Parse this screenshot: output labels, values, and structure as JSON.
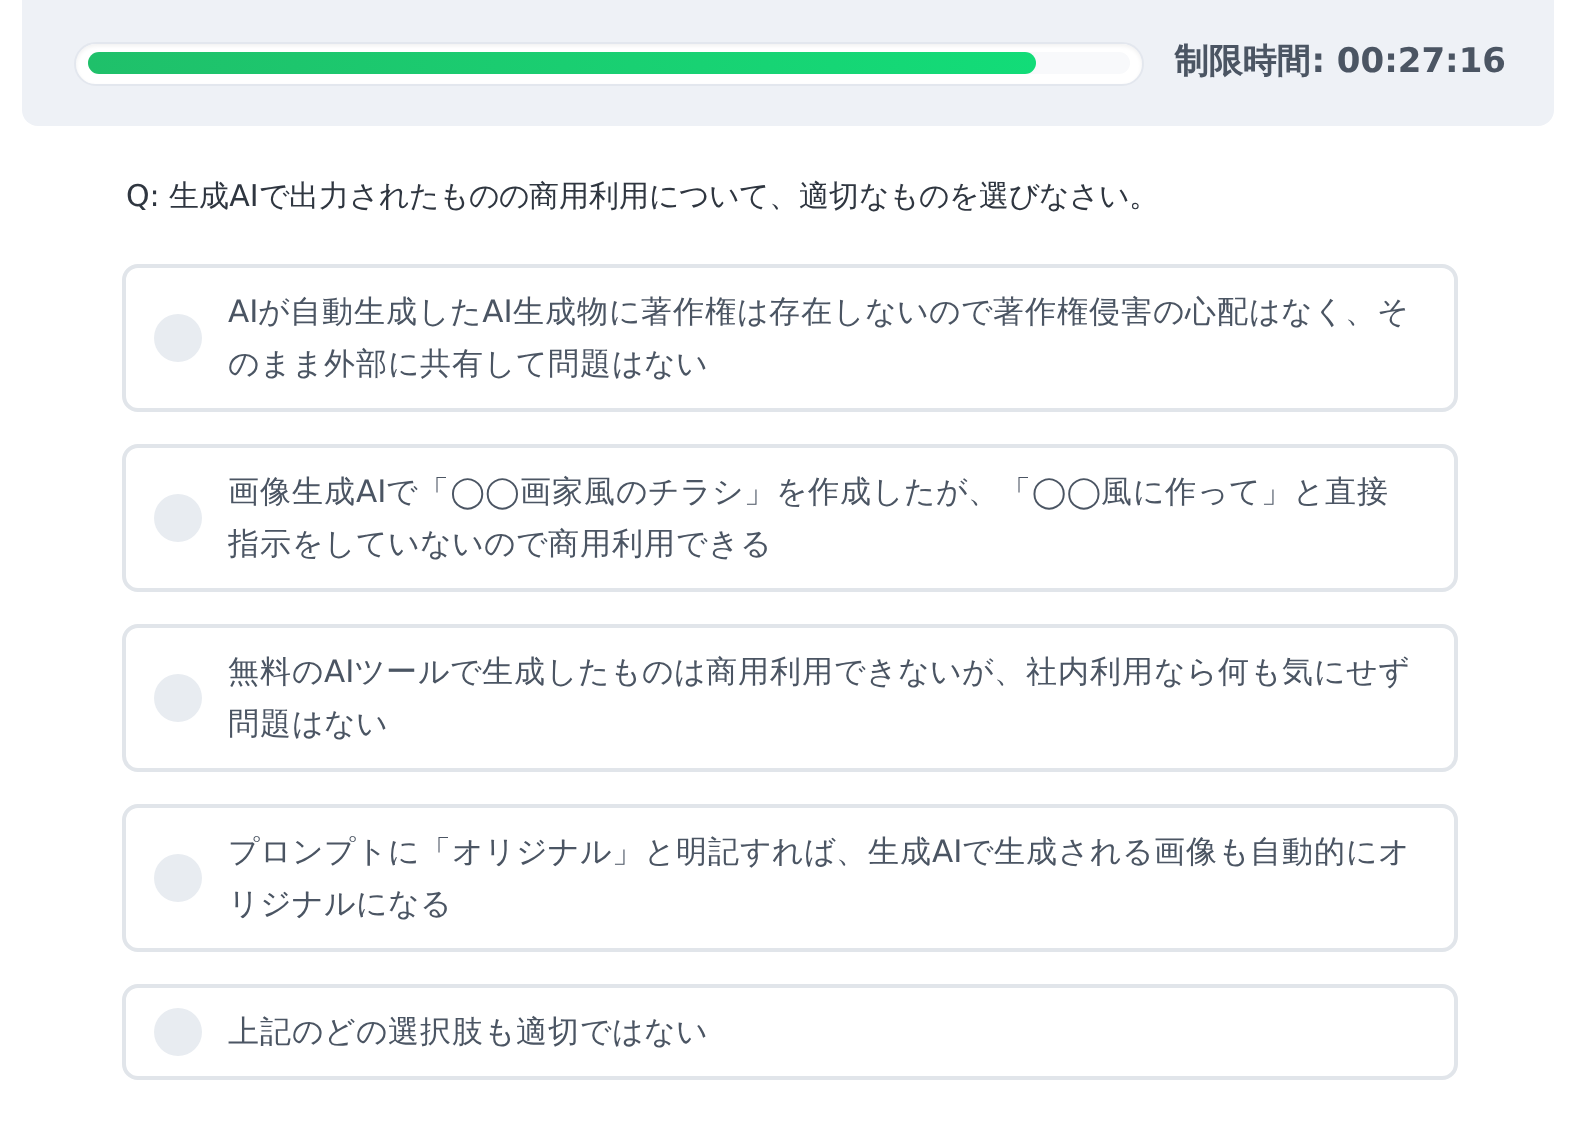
{
  "progress": {
    "level": 0.91
  },
  "timer": "制限時間: 00:27:16",
  "question": "Q: 生成AIで出力されたものの商用利用について、適切なものを選びなさい。",
  "options": [
    {
      "text": "AIが自動生成したAI生成物に著作権は存在しないので著作権侵害の心配はなく、そのまま外部に共有して問題はない",
      "selected": false
    },
    {
      "text": "画像生成AIで「◯◯画家風のチラシ」を作成したが、「◯◯風に作って」と直接指示をしていないので商用利用できる",
      "selected": false
    },
    {
      "text": "無料のAIツールで生成したものは商用利用できないが、社内利用なら何も気にせず問題はない",
      "selected": false
    },
    {
      "text": "プロンプトに「オリジナル」と明記すれば、生成AIで生成される画像も自動的にオリジナルになる",
      "selected": false
    },
    {
      "text": "上記のどの選択肢も適切ではない",
      "selected": false
    }
  ]
}
